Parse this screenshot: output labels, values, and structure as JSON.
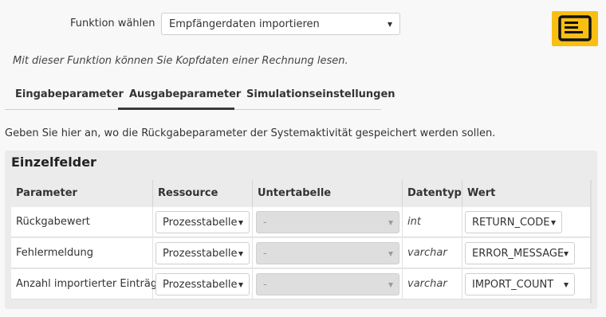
{
  "function": {
    "label": "Funktion wählen",
    "selected": "Empfängerdaten importieren"
  },
  "description": "Mit dieser Funktion können Sie Kopfdaten einer Rechnung lesen.",
  "tabs": [
    {
      "label": "Eingabeparameter",
      "active": false
    },
    {
      "label": "Ausgabeparameter",
      "active": true
    },
    {
      "label": "Simulationseinstellungen",
      "active": false
    }
  ],
  "info": "Geben Sie hier an, wo die Rückgabeparameter der Systemaktivität gespeichert werden sollen.",
  "panel": {
    "title": "Einzelfelder",
    "columns": [
      "Parameter",
      "Ressource",
      "Untertabelle",
      "Datentyp",
      "Wert"
    ],
    "rows": [
      {
        "parameter": "Rückgabewert",
        "resource": "Prozesstabelle",
        "subtable": "-",
        "type": "int",
        "value": "RETURN_CODE"
      },
      {
        "parameter": "Fehlermeldung",
        "resource": "Prozesstabelle",
        "subtable": "-",
        "type": "varchar",
        "value": "ERROR_MESSAGE"
      },
      {
        "parameter": "Anzahl importierter Einträge",
        "resource": "Prozesstabelle",
        "subtable": "-",
        "type": "varchar",
        "value": "IMPORT_COUNT"
      }
    ]
  },
  "colors": {
    "accent": "#f8bf12",
    "panel": "#ebebeb",
    "background": "#f8f8f8"
  },
  "icons": {
    "logo": "document-list-icon",
    "dropdown": "chevron-down-icon"
  }
}
